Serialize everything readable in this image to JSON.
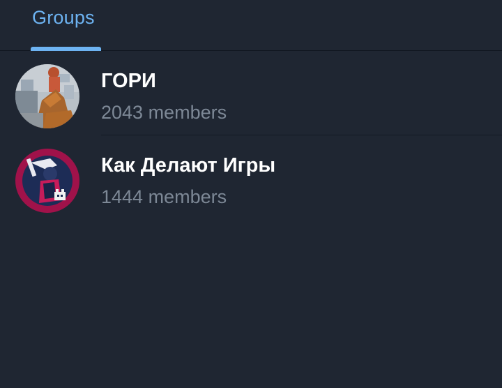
{
  "tabs": [
    {
      "label": "Groups",
      "active": true
    }
  ],
  "groups": [
    {
      "name": "ГОРИ",
      "members": "2043 members"
    },
    {
      "name": "Как Делают Игры",
      "members": "1444 members"
    }
  ],
  "colors": {
    "background": "#1f2632",
    "accent": "#6db3f2",
    "title_text": "#ffffff",
    "secondary_text": "#7d8896",
    "avatar2_bg": "#a0124a"
  }
}
